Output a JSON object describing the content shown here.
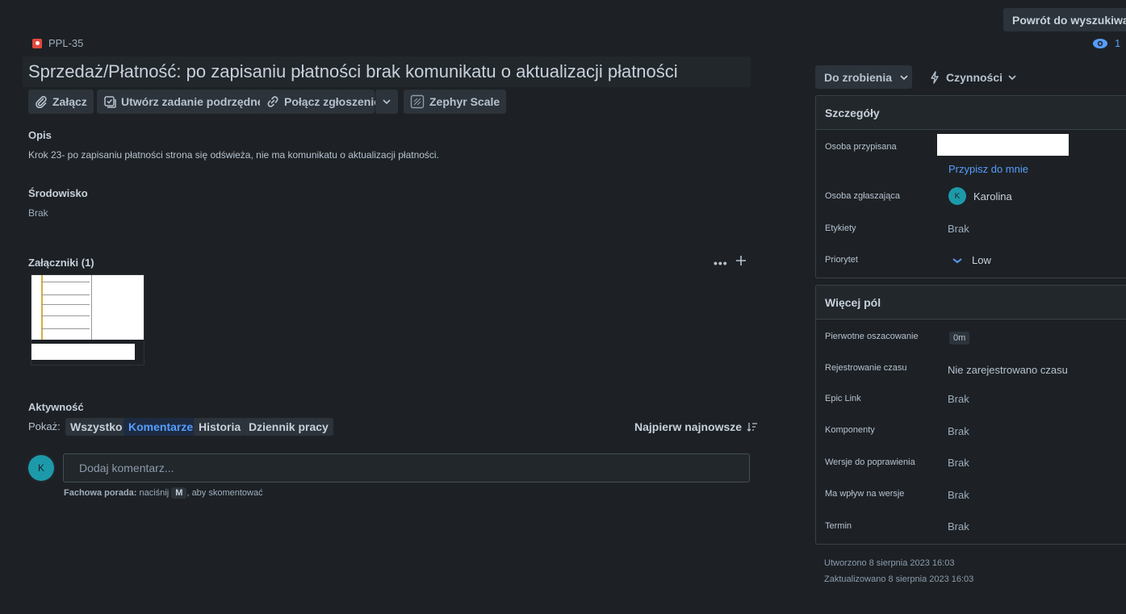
{
  "header": {
    "back_label": "Powrót do wyszukiwania",
    "watchers_count": "1",
    "issue_key": "PPL-35",
    "title": "Sprzedaż/Płatność: po zapisaniu płatności brak komunikatu o aktualizacji płatności"
  },
  "toolbar": {
    "attach": "Załącz",
    "create_subtask": "Utwórz zadanie podrzędne",
    "link_issue": "Połącz zgłoszenie",
    "zephyr": "Zephyr Scale"
  },
  "description": {
    "heading": "Opis",
    "text": "Krok 23- po zapisaniu płatności strona się odświeża, nie ma komunikatu o aktualizacji płatności."
  },
  "environment": {
    "heading": "Środowisko",
    "value": "Brak"
  },
  "attachments": {
    "heading": "Załączniki (1)"
  },
  "activity": {
    "heading": "Aktywność",
    "show_label": "Pokaż:",
    "tabs": [
      "Wszystko",
      "Komentarze",
      "Historia",
      "Dziennik pracy"
    ],
    "active_tab": "Komentarze",
    "sort_label": "Najpierw najnowsze",
    "avatar_initial": "K",
    "comment_placeholder": "Dodaj komentarz...",
    "tip_bold": "Fachowa porada:",
    "tip_before": "naciśnij",
    "tip_key": "M",
    "tip_after": ", aby skomentować"
  },
  "status": {
    "status_label": "Do zrobienia",
    "actions_label": "Czynności"
  },
  "details": {
    "heading": "Szczegóły",
    "assignee_label": "Osoba przypisana",
    "assign_to_me": "Przypisz do mnie",
    "reporter_label": "Osoba zgłaszająca",
    "reporter_initial": "K",
    "reporter_name": "Karolina",
    "labels_label": "Etykiety",
    "labels_value": "Brak",
    "priority_label": "Priorytet",
    "priority_value": "Low"
  },
  "more_fields": {
    "heading": "Więcej pól",
    "rows": [
      {
        "label": "Pierwotne oszacowanie",
        "value": "0m"
      },
      {
        "label": "Rejestrowanie czasu",
        "value": "Nie zarejestrowano czasu"
      },
      {
        "label": "Epic Link",
        "value": "Brak"
      },
      {
        "label": "Komponenty",
        "value": "Brak"
      },
      {
        "label": "Wersje do poprawienia",
        "value": "Brak"
      },
      {
        "label": "Ma wpływ na wersje",
        "value": "Brak"
      },
      {
        "label": "Termin",
        "value": "Brak"
      }
    ]
  },
  "dates": {
    "created": "Utworzono 8 sierpnia 2023 16:03",
    "updated": "Zaktualizowano 8 sierpnia 2023 16:03"
  }
}
